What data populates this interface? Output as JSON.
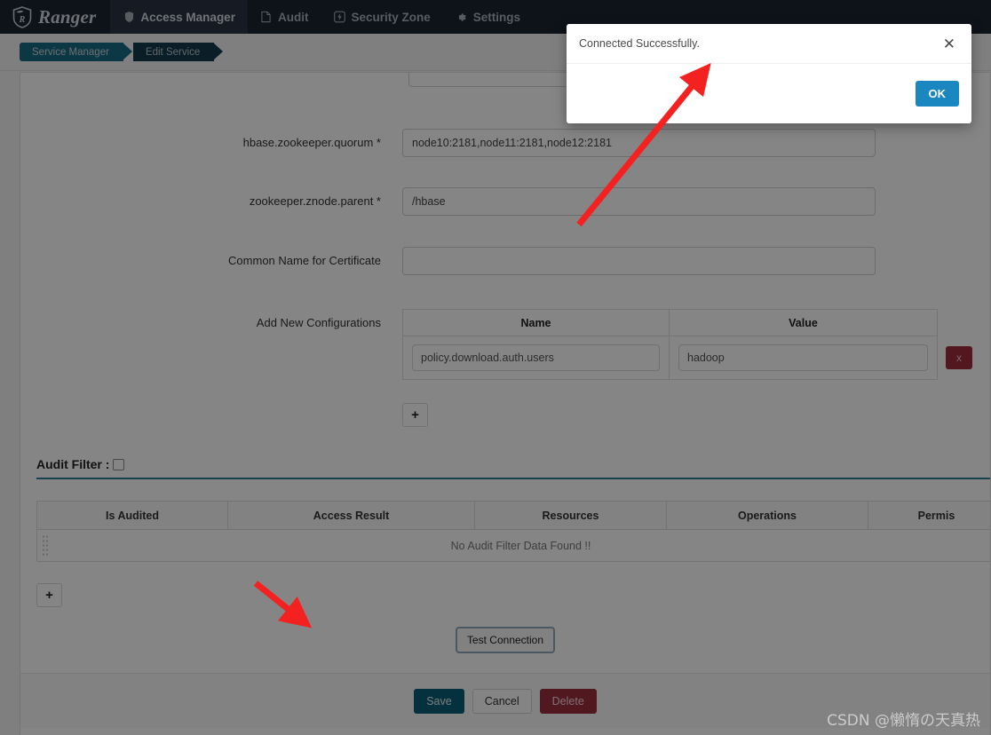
{
  "navbar": {
    "brand": "Ranger",
    "brand_icon": "ranger-shield-logo",
    "items": [
      {
        "label": "Access Manager",
        "icon": "shield-icon",
        "active": true
      },
      {
        "label": "Audit",
        "icon": "file-icon",
        "active": false
      },
      {
        "label": "Security Zone",
        "icon": "bolt-icon",
        "active": false
      },
      {
        "label": "Settings",
        "icon": "gear-icon",
        "active": false
      }
    ]
  },
  "breadcrumb": {
    "items": [
      {
        "label": "Service Manager"
      },
      {
        "label": "Edit Service"
      }
    ]
  },
  "form": {
    "fields": [
      {
        "label": "hbase.zookeeper.quorum *",
        "value": "node10:2181,node11:2181,node12:2181",
        "placeholder": ""
      },
      {
        "label": "zookeeper.znode.parent *",
        "value": "/hbase",
        "placeholder": ""
      },
      {
        "label": "Common Name for Certificate",
        "value": "",
        "placeholder": ""
      }
    ],
    "add_new_configurations": {
      "label": "Add New Configurations",
      "columns": [
        "Name",
        "Value"
      ],
      "rows": [
        {
          "name": "policy.download.auth.users",
          "value": "hadoop",
          "delete_label": "x"
        }
      ],
      "add_button_label": "+"
    }
  },
  "audit_filter": {
    "label": "Audit Filter :",
    "checked": false,
    "columns": [
      "Is Audited",
      "Access Result",
      "Resources",
      "Operations",
      "Permis"
    ],
    "empty_message": "No Audit Filter Data Found !!",
    "add_button_label": "+"
  },
  "actions": {
    "test_connection": "Test Connection",
    "save": "Save",
    "cancel": "Cancel",
    "delete": "Delete"
  },
  "modal": {
    "message": "Connected Successfully.",
    "close_label": "✕",
    "ok_label": "OK"
  },
  "watermark": "CSDN @懒惰の天真热",
  "colors": {
    "navbar_bg": "#1b2430",
    "crumb_active": "#176a84",
    "crumb_current": "#133a4a",
    "accent_blue": "#1a87c0",
    "save_teal": "#0b5e77",
    "delete_red": "#9e2f3e",
    "row_delete_red": "#a02c3e",
    "audit_rule": "#2d7e93",
    "arrow_red": "#f42121"
  }
}
